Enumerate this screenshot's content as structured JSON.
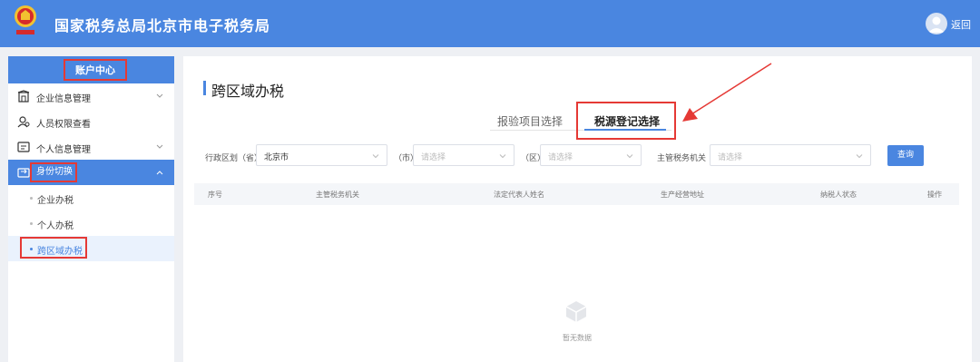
{
  "header": {
    "title": "国家税务总局北京市电子税务局",
    "back_label": "返回",
    "brand_color": "#4a86e0"
  },
  "sidebar": {
    "header": "账户中心",
    "items": [
      {
        "label": "企业信息管理",
        "icon": "building-icon",
        "expandable": true
      },
      {
        "label": "人员权限查看",
        "icon": "user-permission-icon",
        "expandable": false
      },
      {
        "label": "个人信息管理",
        "icon": "id-card-icon",
        "expandable": true
      },
      {
        "label": "身份切换",
        "icon": "switch-icon",
        "expandable": true,
        "expanded": true
      }
    ],
    "sub_items": [
      {
        "label": "企业办税"
      },
      {
        "label": "个人办税"
      },
      {
        "label": "跨区域办税",
        "active": true
      }
    ]
  },
  "main": {
    "title": "跨区域办税",
    "tabs": [
      {
        "label": "报验项目选择",
        "active": false
      },
      {
        "label": "税源登记选择",
        "active": true
      }
    ],
    "filters": {
      "region_label": "行政区划（省）",
      "province_value": "北京市",
      "city_label": "（市）",
      "city_placeholder": "请选择",
      "district_label": "（区）",
      "district_placeholder": "请选择",
      "tax_authority_label": "主管税务机关",
      "tax_authority_placeholder": "请选择",
      "query_label": "查询"
    },
    "table": {
      "columns": [
        "序号",
        "主管税务机关",
        "法定代表人姓名",
        "生产经营地址",
        "纳税人状态",
        "操作"
      ]
    },
    "empty_text": "暂无数据"
  },
  "colors": {
    "highlight": "#e53935",
    "accent": "#4a86e0"
  }
}
